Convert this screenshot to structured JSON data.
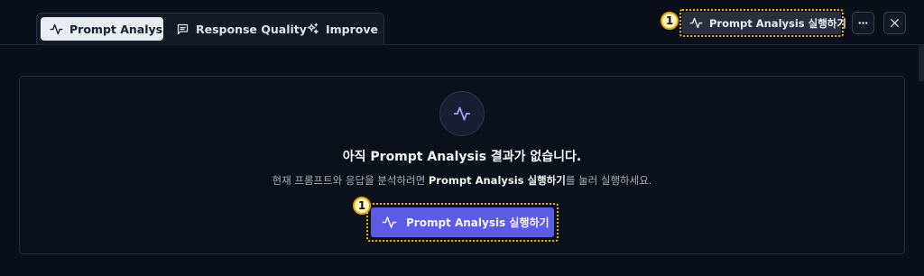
{
  "tabs": [
    {
      "label": "Prompt Analysis",
      "icon": "activity-icon",
      "active": true
    },
    {
      "label": "Response Quality",
      "icon": "message-square-icon",
      "active": false
    },
    {
      "label": "Improve",
      "icon": "sparkles-icon",
      "active": false
    }
  ],
  "toolbar": {
    "run_label": "Prompt Analysis 실행하기",
    "run_icon": "activity-icon",
    "more_icon": "more-horizontal-icon",
    "close_icon": "close-icon",
    "badge_number": "1"
  },
  "empty_state": {
    "icon": "activity-icon",
    "title": "아직 Prompt Analysis 결과가 없습니다.",
    "desc_before": "현재 프롬프트와 응답을 분석하려면 ",
    "desc_strong": "Prompt Analysis 실행하기",
    "desc_after": "를 눌러 실행하세요.",
    "cta_label": "Prompt Analysis 실행하기",
    "badge_number": "1"
  },
  "colors": {
    "background": "#0b0f1a",
    "accent": "#5b5be6",
    "highlight": "#f5b400"
  }
}
